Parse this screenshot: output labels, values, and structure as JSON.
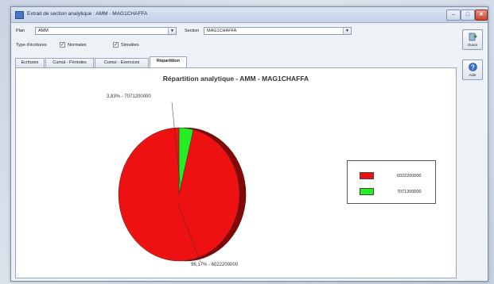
{
  "window": {
    "title": "Extrait de section analytique : AMM - MAG1CHAFFA"
  },
  "form": {
    "plan_label": "Plan",
    "plan_value": "AMM",
    "section_label": "Section",
    "section_value": "MAG1CHAFFA",
    "type_label": "Type d'écritures",
    "normales_label": "Normales",
    "simulees_label": "Simulées",
    "normales_checked": true,
    "simulees_checked": true
  },
  "tabs": [
    "Ecritures",
    "Cumul - Périodes",
    "Cumul - Exercices",
    "Répartition"
  ],
  "active_tab": "Répartition",
  "side_buttons": {
    "close_label": "Ouvrir",
    "help_label": "Aide"
  },
  "chart_data": {
    "type": "pie",
    "title": "Répartition analytique - AMM - MAG1CHAFFA",
    "slices": [
      {
        "label": "6022200000",
        "value": 96.17,
        "color": "#ee1111",
        "data_label": "96,17% - 6022200000"
      },
      {
        "label": "7071200000",
        "value": 3.83,
        "color": "#22ee22",
        "data_label": "3,83% - 7071200000"
      }
    ],
    "legend": {
      "position": "right",
      "entries": [
        "6022200000",
        "7071200000"
      ]
    }
  }
}
